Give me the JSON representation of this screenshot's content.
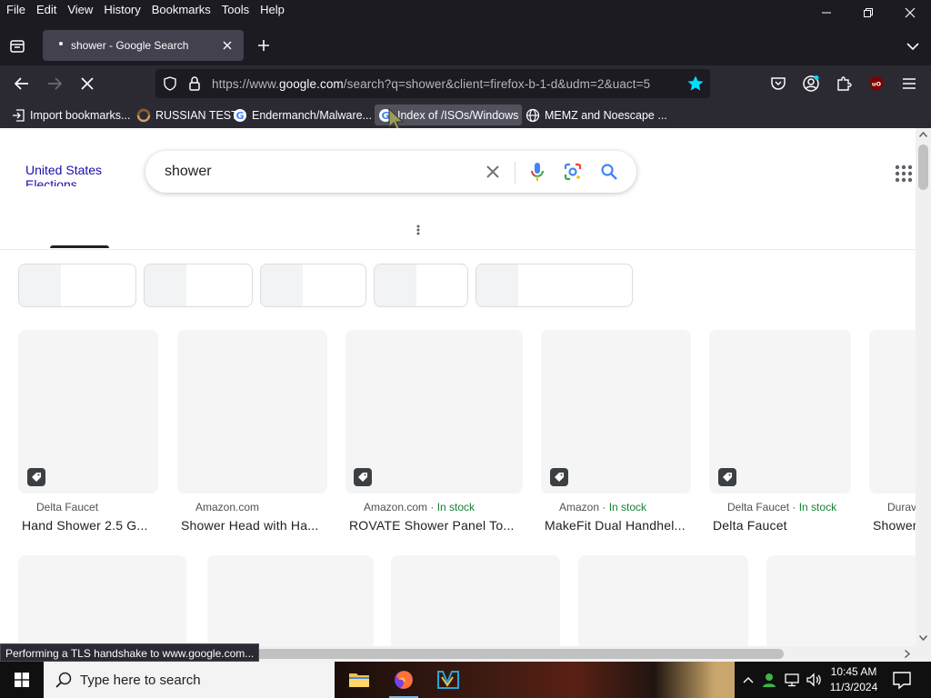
{
  "menubar": {
    "items": [
      "File",
      "Edit",
      "View",
      "History",
      "Bookmarks",
      "Tools",
      "Help"
    ]
  },
  "tab": {
    "title": "shower - Google Search"
  },
  "urlbar": {
    "url_prefix": "https://www.",
    "url_domain": "google.com",
    "url_rest": "/search?q=shower&client=firefox-b-1-d&udm=2&uact=5"
  },
  "bookmarks": [
    {
      "label": "Import bookmarks...",
      "icon": "import-icon"
    },
    {
      "label": "RUSSIAN TEST",
      "icon": "site-icon"
    },
    {
      "label": "Endermanch/Malware...",
      "icon": "google-icon"
    },
    {
      "label": "Index of /ISOs/Windows",
      "icon": "google-icon"
    },
    {
      "label": "MEMZ and Noescape ...",
      "icon": "globe-icon"
    }
  ],
  "google": {
    "doodle_text": "United States Elections",
    "query": "shower"
  },
  "products": [
    {
      "seller": "Delta Faucet",
      "stock": "",
      "title": "Hand Shower 2.5 G..."
    },
    {
      "seller": "Amazon.com",
      "stock": "",
      "title": "Shower Head with Ha..."
    },
    {
      "seller": "Amazon.com",
      "stock": "In stock",
      "title": "ROVATE Shower Panel To..."
    },
    {
      "seller": "Amazon",
      "stock": "In stock",
      "title": "MakeFit Dual Handhel..."
    },
    {
      "seller": "Delta Faucet",
      "stock": "In stock",
      "title": "Delta Faucet"
    },
    {
      "seller": "Durav",
      "stock": "",
      "title": "Shower"
    }
  ],
  "status": {
    "text": "Performing a TLS handshake to www.google.com..."
  },
  "taskbar": {
    "search_placeholder": "Type here to search",
    "time": "10:45 AM",
    "date": "11/3/2024"
  },
  "colors": {
    "chrome_dark": "#1c1b22",
    "toolbar": "#2b2a33",
    "tab_active": "#42414d",
    "in_stock_green": "#188038",
    "star_blue": "#00ddff"
  }
}
